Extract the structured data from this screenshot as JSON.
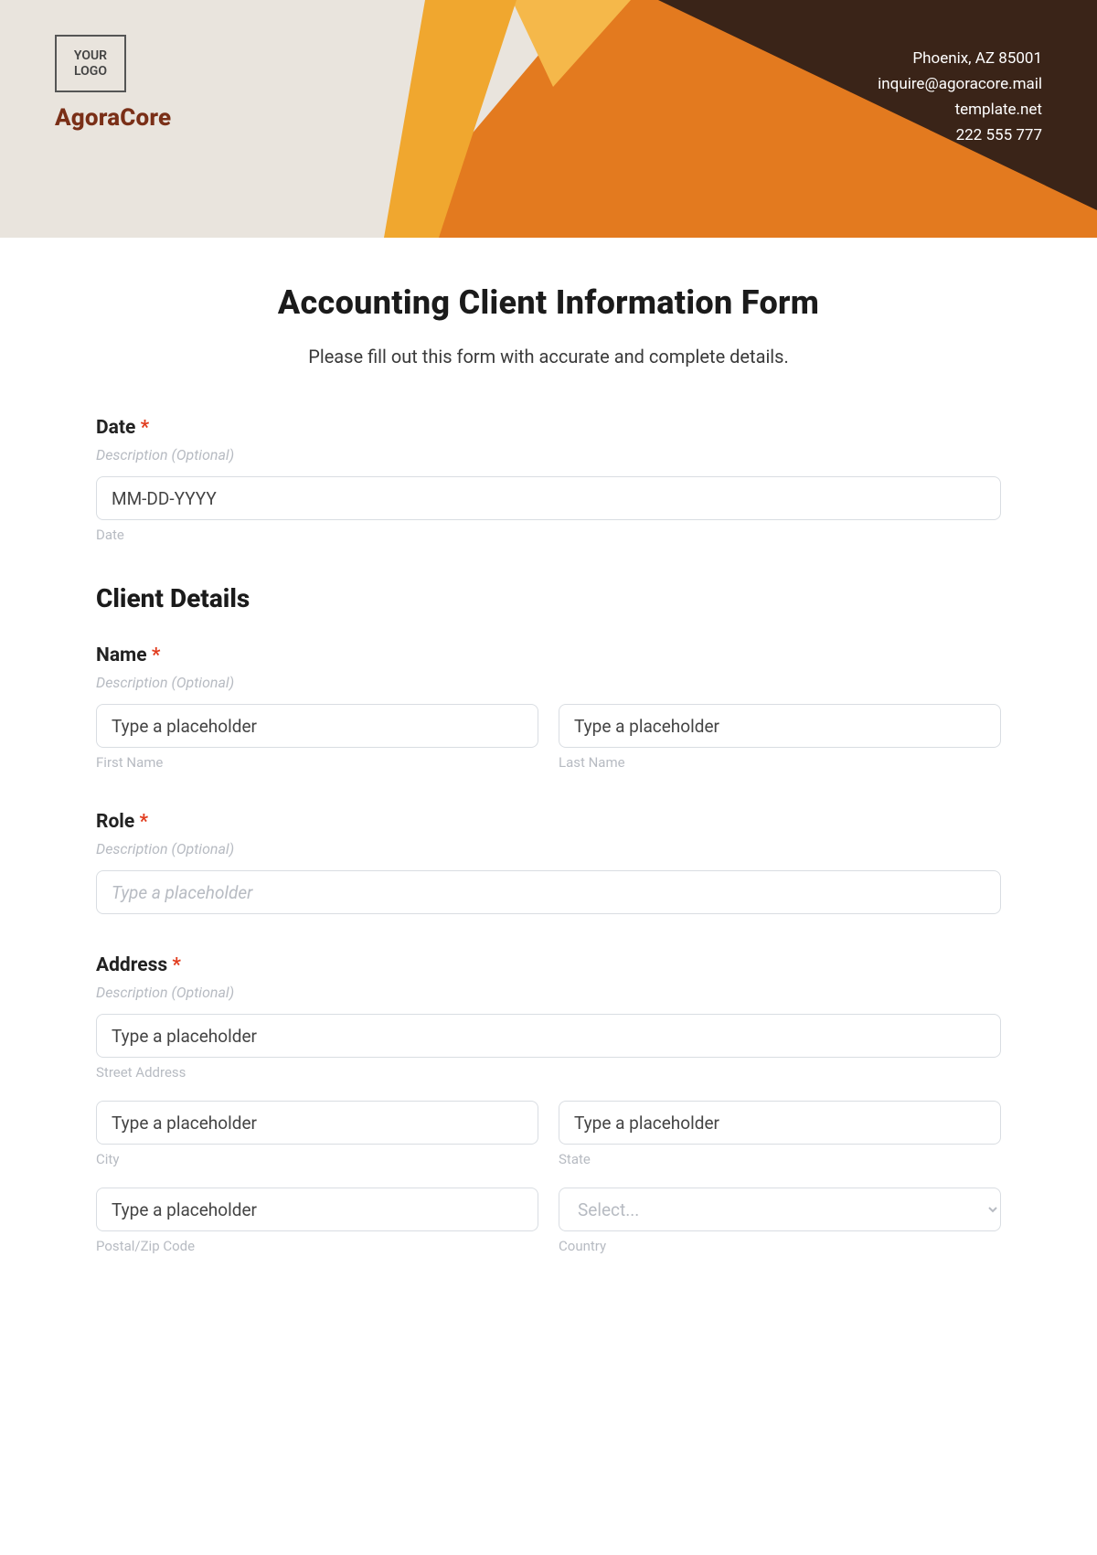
{
  "header": {
    "logo_text": "YOUR\nLOGO",
    "brand": "AgoraCore",
    "contact": {
      "line1": "Phoenix, AZ 85001",
      "line2": "inquire@agoracore.mail",
      "line3": "template.net",
      "line4": "222 555 777"
    }
  },
  "form": {
    "title": "Accounting Client Information Form",
    "subtitle": "Please fill out this form with accurate and complete details.",
    "required_marker": "*",
    "description_hint": "Description (Optional)",
    "date": {
      "label": "Date",
      "placeholder": "MM-DD-YYYY",
      "sublabel": "Date"
    },
    "section_client_details": "Client Details",
    "name": {
      "label": "Name",
      "first_placeholder": "Type a placeholder",
      "first_sublabel": "First Name",
      "last_placeholder": "Type a placeholder",
      "last_sublabel": "Last Name"
    },
    "role": {
      "label": "Role",
      "placeholder": "Type a placeholder"
    },
    "address": {
      "label": "Address",
      "street_placeholder": "Type a placeholder",
      "street_sublabel": "Street Address",
      "city_placeholder": "Type a placeholder",
      "city_sublabel": "City",
      "state_placeholder": "Type a placeholder",
      "state_sublabel": "State",
      "postal_placeholder": "Type a placeholder",
      "postal_sublabel": "Postal/Zip Code",
      "country_placeholder": "Select...",
      "country_sublabel": "Country"
    }
  }
}
